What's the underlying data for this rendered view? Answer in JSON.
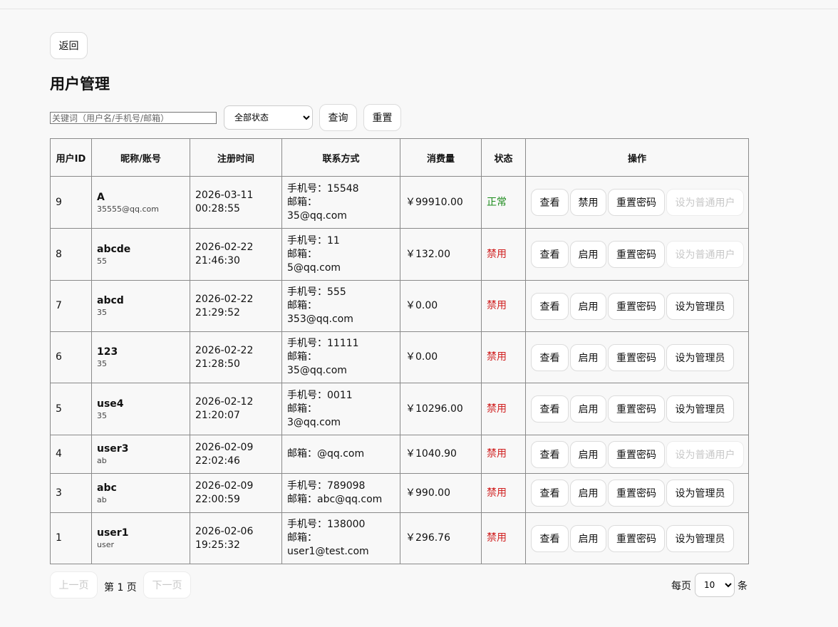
{
  "back_label": "返回",
  "title": "用户管理",
  "filters": {
    "placeholder": "关键词（用户名/手机号/邮箱）",
    "status_selected": "全部状态",
    "query_label": "查询",
    "reset_label": "重置"
  },
  "table": {
    "headers": [
      "用户ID",
      "昵称/账号",
      "注册时间",
      "联系方式",
      "消费量",
      "状态",
      "操作"
    ],
    "rows": [
      {
        "id": "9",
        "nick": "A",
        "acct": "35555@qq.com",
        "date": "2026-03-11",
        "time": "00:28:55",
        "phone_line": "手机号：15548",
        "email_label": "邮箱：",
        "email_value": "35@qq.com",
        "amount": "￥99910.00",
        "status": "正常",
        "status_class": "st-normal",
        "op_view": "查看",
        "op_toggle": "禁用",
        "op_reset": "重置密码",
        "op_role": "设为普通用户",
        "role_disabled": true
      },
      {
        "id": "8",
        "nick": "abcde",
        "acct": "55",
        "date": "2026-02-22",
        "time": "21:46:30",
        "phone_line": "手机号：11",
        "email_label": "邮箱：",
        "email_value": "5@qq.com",
        "amount": "￥132.00",
        "status": "禁用",
        "status_class": "st-disabled",
        "op_view": "查看",
        "op_toggle": "启用",
        "op_reset": "重置密码",
        "op_role": "设为普通用户",
        "role_disabled": true
      },
      {
        "id": "7",
        "nick": "abcd",
        "acct": "35",
        "date": "2026-02-22",
        "time": "21:29:52",
        "phone_line": "手机号：555",
        "email_label": "邮箱：",
        "email_value": "353@qq.com",
        "amount": "￥0.00",
        "status": "禁用",
        "status_class": "st-disabled",
        "op_view": "查看",
        "op_toggle": "启用",
        "op_reset": "重置密码",
        "op_role": "设为管理员",
        "role_disabled": false
      },
      {
        "id": "6",
        "nick": "123",
        "acct": "35",
        "date": "2026-02-22",
        "time": "21:28:50",
        "phone_line": "手机号：11111",
        "email_label": "邮箱：",
        "email_value": "35@qq.com",
        "amount": "￥0.00",
        "status": "禁用",
        "status_class": "st-disabled",
        "op_view": "查看",
        "op_toggle": "启用",
        "op_reset": "重置密码",
        "op_role": "设为管理员",
        "role_disabled": false
      },
      {
        "id": "5",
        "nick": "use4",
        "acct": "35",
        "date": "2026-02-12",
        "time": "21:20:07",
        "phone_line": "手机号：0011",
        "email_label": "邮箱：",
        "email_value": "3@qq.com",
        "amount": "￥10296.00",
        "status": "禁用",
        "status_class": "st-disabled",
        "op_view": "查看",
        "op_toggle": "启用",
        "op_reset": "重置密码",
        "op_role": "设为管理员",
        "role_disabled": false
      },
      {
        "id": "4",
        "nick": "user3",
        "acct": "ab",
        "date": "2026-02-09",
        "time": "22:02:46",
        "phone_line": "",
        "email_label": "",
        "email_value": "邮箱：@qq.com",
        "amount": "￥1040.90",
        "status": "禁用",
        "status_class": "st-disabled",
        "op_view": "查看",
        "op_toggle": "启用",
        "op_reset": "重置密码",
        "op_role": "设为普通用户",
        "role_disabled": true
      },
      {
        "id": "3",
        "nick": "abc",
        "acct": "ab",
        "date": "2026-02-09",
        "time": "22:00:59",
        "phone_line": "手机号：789098",
        "email_label": "",
        "email_value": "邮箱：abc@qq.com",
        "amount": "￥990.00",
        "status": "禁用",
        "status_class": "st-disabled",
        "op_view": "查看",
        "op_toggle": "启用",
        "op_reset": "重置密码",
        "op_role": "设为管理员",
        "role_disabled": false
      },
      {
        "id": "1",
        "nick": "user1",
        "acct": "user",
        "date": "2026-02-06",
        "time": "19:25:32",
        "phone_line": "手机号：138000",
        "email_label": "邮箱：",
        "email_value": "user1@test.com",
        "amount": "￥296.76",
        "status": "禁用",
        "status_class": "st-disabled",
        "op_view": "查看",
        "op_toggle": "启用",
        "op_reset": "重置密码",
        "op_role": "设为管理员",
        "role_disabled": false
      }
    ]
  },
  "pager": {
    "prev_label": "上一页",
    "page_text": "第 1 页",
    "next_label": "下一页",
    "per_page_label": "每页",
    "per_page_value": "10",
    "per_page_unit": "条"
  }
}
